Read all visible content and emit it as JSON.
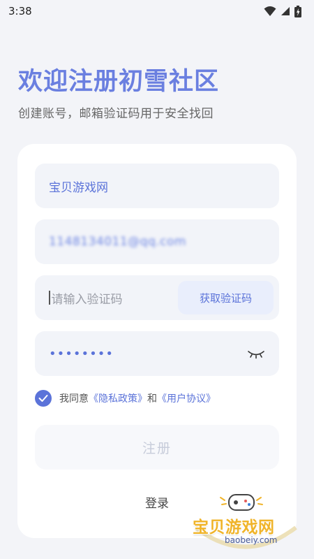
{
  "status_bar": {
    "time": "3:38"
  },
  "header": {
    "title": "欢迎注册初雪社区",
    "subtitle": "创建账号，邮箱验证码用于安全找回"
  },
  "form": {
    "username_value": "宝贝游戏网",
    "email_value": "1148134011@qq.com",
    "code_placeholder": "请输入验证码",
    "get_code_label": "获取验证码",
    "password_value": "••••••••",
    "agreement": {
      "checked": true,
      "prefix": "我同意",
      "privacy_link": "《隐私政策》",
      "connector": "和",
      "terms_link": "《用户协议》"
    },
    "register_label": "注册",
    "login_label": "登录"
  },
  "watermark": {
    "text": "宝贝游戏网",
    "domain": "baobeiy.com"
  },
  "colors": {
    "accent": "#5b73d9",
    "title": "#6a7fe0",
    "background": "#f3f4f8",
    "field_bg": "#f2f4f9",
    "disabled_text": "#c7ccda"
  }
}
